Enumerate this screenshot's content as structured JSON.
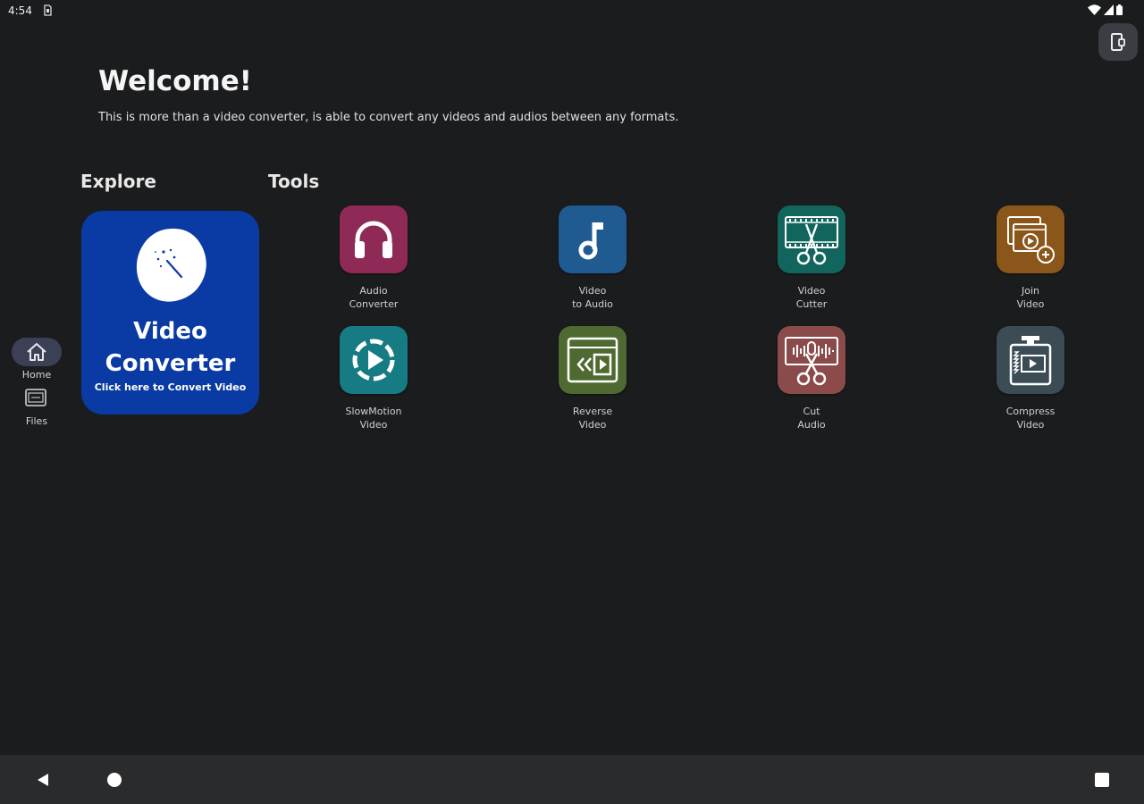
{
  "status_bar": {
    "time": "4:54"
  },
  "header": {
    "title": "Welcome!",
    "description": "This is more than a video converter, is able to convert any videos and audios between any formats."
  },
  "sections": {
    "explore": "Explore",
    "tools": "Tools"
  },
  "nav_rail": {
    "items": [
      {
        "label": "Home",
        "icon": "home-icon",
        "active": true
      },
      {
        "label": "Files",
        "icon": "files-icon",
        "active": false
      }
    ]
  },
  "explore_card": {
    "title_line1": "Video",
    "title_line2": "Converter",
    "subtitle": "Click here to Convert Video",
    "icon": "magic-wand-blob-icon",
    "color": "#0a3aa3"
  },
  "tools": [
    {
      "label": "Audio\nConverter",
      "icon": "headphones-icon",
      "color": "#8e2a55"
    },
    {
      "label": "Video\nto Audio",
      "icon": "music-note-icon",
      "color": "#1f5a91"
    },
    {
      "label": "Video\nCutter",
      "icon": "film-scissors-icon",
      "color": "#11655c"
    },
    {
      "label": "Join\nVideo",
      "icon": "join-video-icon",
      "color": "#8b561a"
    },
    {
      "label": "SlowMotion\nVideo",
      "icon": "slow-motion-icon",
      "color": "#167b83"
    },
    {
      "label": "Reverse\nVideo",
      "icon": "reverse-video-icon",
      "color": "#4e6a30"
    },
    {
      "label": "Cut\nAudio",
      "icon": "audio-scissors-icon",
      "color": "#8c4b4b"
    },
    {
      "label": "Compress\nVideo",
      "icon": "compress-video-icon",
      "color": "#3b4c55"
    }
  ],
  "system_nav": {
    "back": "back-icon",
    "home": "home-circle-icon",
    "recents": "recents-icon"
  }
}
